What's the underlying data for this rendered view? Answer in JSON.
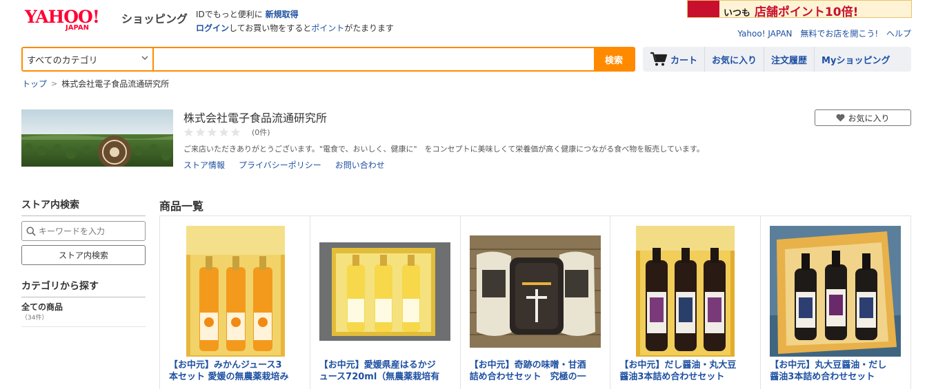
{
  "header": {
    "logo_yahoo": "YAHOO!",
    "logo_japan": "JAPAN",
    "logo_shopping": "ショッピング",
    "promo_line1_prefix": "IDでもっと便利に",
    "promo_signup": "新規取得",
    "promo_login": "ログイン",
    "promo_line2_mid": "してお買い物をすると",
    "promo_points": "ポイント",
    "promo_line2_suffix": "がたまります",
    "banner_main": "店舗ポイント10倍!",
    "banner_prefix": "いつも",
    "top_links": [
      "Yahoo! JAPAN",
      "無料でお店を開こう!",
      "ヘルプ"
    ]
  },
  "search": {
    "category_selected": "すべてのカテゴリ",
    "query": "",
    "button_label": "検索"
  },
  "nav": {
    "cart": "カート",
    "favorites": "お気に入り",
    "order_history": "注文履歴",
    "my_shopping": "Myショッピング"
  },
  "breadcrumb": {
    "top": "トップ",
    "separator": ">",
    "current": "株式会社電子食品流通研究所"
  },
  "store": {
    "name": "株式会社電子食品流通研究所",
    "rating": 0,
    "review_count": "(0件)",
    "description": "ご来店いただきありがとうございます。\"電食で、おいしく、健康に\"　をコンセプトに美味しくて栄養価が高く健康につながる食べ物を販売しています。",
    "links": [
      "ストア情報",
      "プライバシーポリシー",
      "お問い合わせ"
    ],
    "favorite_button": "お気に入り"
  },
  "sidebar": {
    "store_search_title": "ストア内検索",
    "keyword_placeholder": "キーワードを入力",
    "store_search_button": "ストア内検索",
    "category_title": "カテゴリから探す",
    "all_items_label": "全ての商品",
    "all_items_count": "（34件）"
  },
  "products": {
    "section_title": "商品一覧",
    "items": [
      {
        "title_line1": "【お中元】みかんジュース3",
        "title_line2": "本セット 愛媛の無農薬栽培み"
      },
      {
        "title_line1": "【お中元】愛媛県産はるかジ",
        "title_line2": "ュース720ml（無農薬栽培有"
      },
      {
        "title_line1": "【お中元】奇跡の味噌・甘酒",
        "title_line2": "詰め合わせセット　究極の一"
      },
      {
        "title_line1": "【お中元】だし醤油・丸大豆",
        "title_line2": "醤油3本詰め合わせセット"
      },
      {
        "title_line1": "【お中元】丸大豆醤油・だし",
        "title_line2": "醤油3本詰め合わせセット"
      }
    ]
  },
  "colors": {
    "accent_orange": "#ff8a00",
    "link_blue": "#1e50a2",
    "yahoo_red": "#ff0033"
  }
}
